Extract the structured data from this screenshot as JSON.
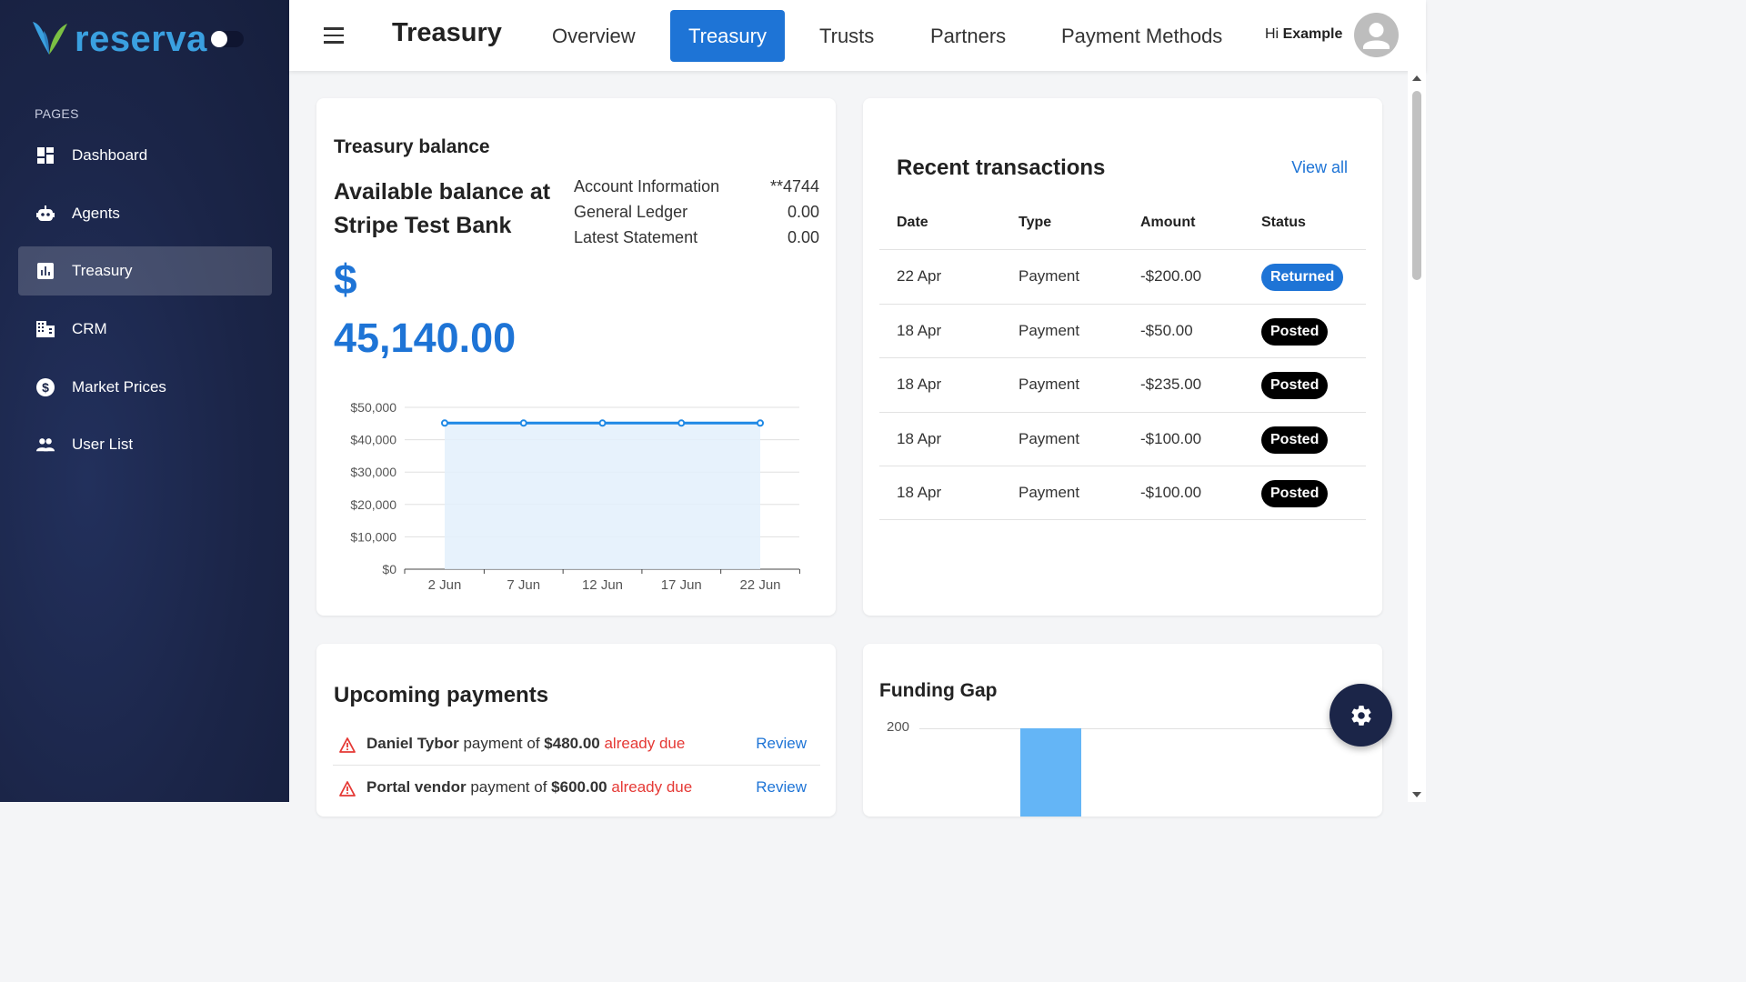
{
  "brand": {
    "name": "reserva"
  },
  "sidebar": {
    "section_label": "PAGES",
    "items": [
      {
        "label": "Dashboard",
        "icon": "dashboard-icon"
      },
      {
        "label": "Agents",
        "icon": "robot-icon"
      },
      {
        "label": "Treasury",
        "icon": "bar-chart-icon",
        "active": true
      },
      {
        "label": "CRM",
        "icon": "building-icon"
      },
      {
        "label": "Market Prices",
        "icon": "dollar-circle-icon"
      },
      {
        "label": "User List",
        "icon": "people-icon"
      }
    ]
  },
  "topbar": {
    "title": "Treasury",
    "tabs": [
      {
        "label": "Overview"
      },
      {
        "label": "Treasury",
        "active": true
      },
      {
        "label": "Trusts"
      },
      {
        "label": "Partners"
      },
      {
        "label": "Payment Methods"
      }
    ],
    "greeting": "Hi",
    "user_name": "Example"
  },
  "balance_card": {
    "title": "Treasury balance",
    "subtitle": "Available balance at Stripe Test Bank",
    "currency_symbol": "$",
    "amount": "45,140.00",
    "account_rows": [
      {
        "label": "Account Information",
        "value": "**4744"
      },
      {
        "label": "General Ledger",
        "value": "0.00"
      },
      {
        "label": "Latest Statement",
        "value": "0.00"
      }
    ]
  },
  "chart_data": {
    "type": "area",
    "x": [
      "2 Jun",
      "7 Jun",
      "12 Jun",
      "17 Jun",
      "22 Jun"
    ],
    "y_ticks": [
      "$50,000",
      "$40,000",
      "$30,000",
      "$20,000",
      "$10,000",
      "$0"
    ],
    "series": [
      {
        "values": [
          45140,
          45140,
          45140,
          45140,
          45140
        ]
      }
    ],
    "ylim": [
      0,
      50000
    ],
    "grid": true,
    "color": "#1e88e5"
  },
  "transactions": {
    "title": "Recent transactions",
    "view_all": "View all",
    "columns": [
      "Date",
      "Type",
      "Amount",
      "Status"
    ],
    "rows": [
      {
        "date": "22 Apr",
        "type": "Payment",
        "amount": "-$200.00",
        "status": "Returned"
      },
      {
        "date": "18 Apr",
        "type": "Payment",
        "amount": "-$50.00",
        "status": "Posted"
      },
      {
        "date": "18 Apr",
        "type": "Payment",
        "amount": "-$235.00",
        "status": "Posted"
      },
      {
        "date": "18 Apr",
        "type": "Payment",
        "amount": "-$100.00",
        "status": "Posted"
      },
      {
        "date": "18 Apr",
        "type": "Payment",
        "amount": "-$100.00",
        "status": "Posted"
      }
    ],
    "status_colors": {
      "Returned": "#1e74d6",
      "Posted": "#000000"
    }
  },
  "upcoming": {
    "title": "Upcoming payments",
    "rows": [
      {
        "name": "Daniel Tybor",
        "text": "payment of",
        "amount": "$480.00",
        "due": "already due",
        "action": "Review"
      },
      {
        "name": "Portal vendor",
        "text": "payment of",
        "amount": "$600.00",
        "due": "already due",
        "action": "Review"
      }
    ]
  },
  "funding_gap": {
    "title": "Funding Gap",
    "y_tick": "200"
  },
  "colors": {
    "accent": "#1e74d6",
    "sidebar": "#1b2548",
    "danger": "#e53935"
  }
}
